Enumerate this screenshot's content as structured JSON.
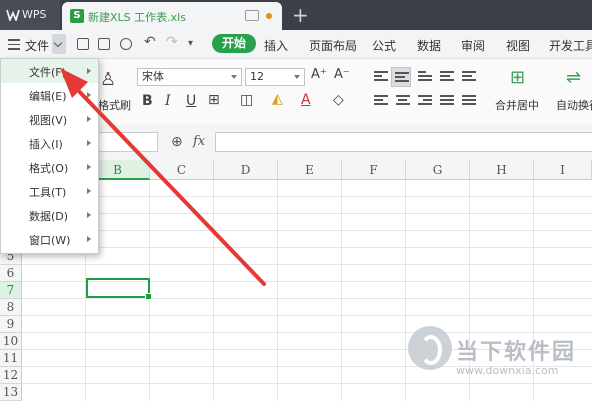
{
  "titlebar": {
    "app_label": "WPS",
    "doc_tab_icon": "S",
    "doc_tab_title": "新建XLS 工作表.xls",
    "new_tab": "+"
  },
  "menubar": {
    "file_menu": "文件",
    "start_button": "开始",
    "tabs": [
      "插入",
      "页面布局",
      "公式",
      "数据",
      "审阅",
      "视图",
      "开发工具"
    ]
  },
  "ribbon": {
    "format_painter": "格式刷",
    "font_name": "宋体",
    "font_size": "12",
    "bold": "B",
    "italic": "I",
    "underline": "U",
    "merge_center": "合并居中",
    "auto_wrap": "自动换行",
    "grow_font": "A⁺",
    "shrink_font": "A⁻"
  },
  "formula_bar": {
    "zoom_icon": "⊕",
    "fx_label": "fx",
    "formula_value": ""
  },
  "sheet": {
    "columns": [
      "B",
      "C",
      "D",
      "E",
      "F",
      "G",
      "H",
      "I"
    ],
    "rows": [
      "5",
      "6",
      "7",
      "8",
      "9",
      "10",
      "11",
      "12",
      "13"
    ],
    "selected_column": "B",
    "selected_row": "7"
  },
  "file_dropdown": {
    "items": [
      "文件(F)",
      "编辑(E)",
      "视图(V)",
      "插入(I)",
      "格式(O)",
      "工具(T)",
      "数据(D)",
      "窗口(W)"
    ],
    "highlighted": "文件(F)"
  },
  "watermark": {
    "name": "当下软件园",
    "url": "www.downxia.com"
  },
  "colors": {
    "accent_green": "#27a24a",
    "titlebar": "#3b3f47",
    "arrow_red": "#e53935"
  }
}
